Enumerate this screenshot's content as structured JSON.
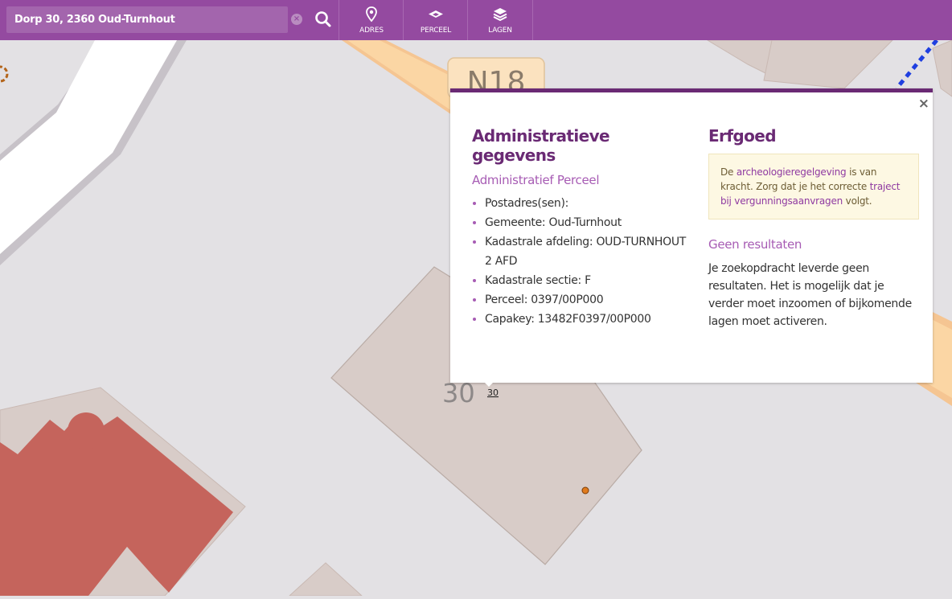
{
  "search": {
    "value": "Dorp 30, 2360 Oud-Turnhout"
  },
  "toolbar": {
    "adres_label": "ADRES",
    "perceel_label": "PERCEEL",
    "lagen_label": "LAGEN"
  },
  "map": {
    "road_label": "N18",
    "house_number_large": "30",
    "house_number_small": "30"
  },
  "popup": {
    "close_symbol": "×",
    "admin": {
      "title": "Administratieve gegevens",
      "subtitle": "Administratief Perceel",
      "items": [
        "Postadres(sen):",
        "Gemeente: Oud-Turnhout",
        "Kadastrale afdeling: OUD-TURNHOUT 2 AFD",
        "Kadastrale sectie: F",
        "Perceel: 0397/00P000",
        "Capakey: 13482F0397/00P000"
      ]
    },
    "erfgoed": {
      "title": "Erfgoed",
      "notice_text_1": "De ",
      "notice_link_1": "archeologieregelgeving",
      "notice_text_2": " is van kracht. Zorg dat je het correcte ",
      "notice_link_2": "traject bij vergunningsaanvragen",
      "notice_text_3": " volgt.",
      "no_results_title": "Geen resultaten",
      "no_results_text": "Je zoekopdracht leverde geen resultaten. Het is mogelijk dat je verder moet inzoomen of bijkomende lagen moet activeren."
    }
  },
  "colors": {
    "toolbar": "#944aa0",
    "accent": "#6a2a74",
    "link": "#8f3aa1",
    "building_red": "#c5645c",
    "parcel": "#d8ccc8",
    "road_orange": "#fbd6a4"
  }
}
